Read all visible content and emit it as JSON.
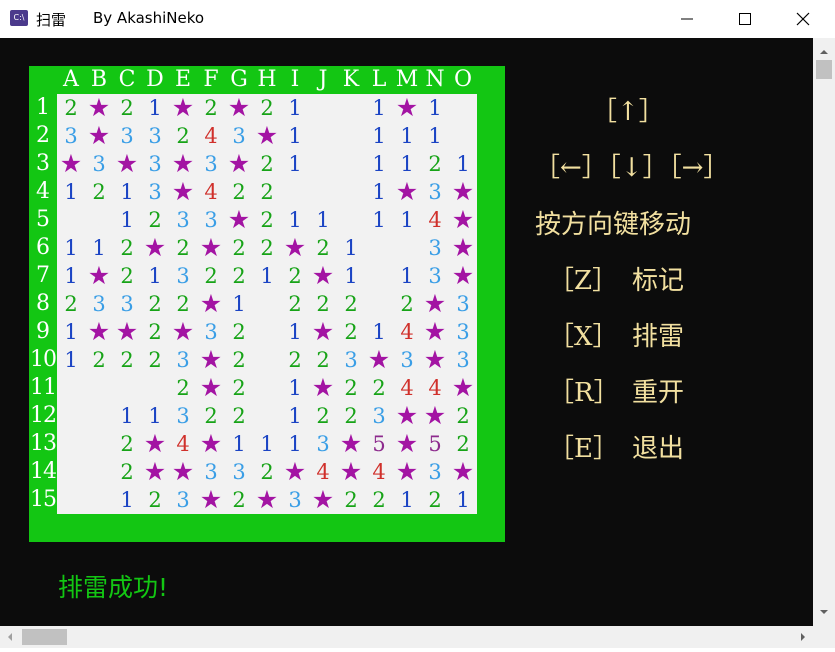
{
  "window": {
    "title": "扫雷",
    "author": "By AkashiNeko",
    "icon_label": "C:\\"
  },
  "colors": {
    "board_green": "#13c613",
    "mine": "#a314a3",
    "text_yellow": "#f2e0a0",
    "console_bg": "#0c0c0c"
  },
  "columns": [
    "A",
    "B",
    "C",
    "D",
    "E",
    "F",
    "G",
    "H",
    "I",
    "J",
    "K",
    "L",
    "M",
    "N",
    "O"
  ],
  "rows": [
    "1",
    "2",
    "3",
    "4",
    "5",
    "6",
    "7",
    "8",
    "9",
    "10",
    "11",
    "12",
    "13",
    "14",
    "15"
  ],
  "grid": [
    [
      "2",
      "*",
      "2",
      "1",
      "*",
      "2",
      "*",
      "2",
      "1",
      "",
      "",
      "1",
      "*",
      "1",
      ""
    ],
    [
      "3",
      "*",
      "3",
      "3",
      "2",
      "4",
      "3",
      "*",
      "1",
      "",
      "",
      "1",
      "1",
      "1",
      ""
    ],
    [
      "*",
      "3",
      "*",
      "3",
      "*",
      "3",
      "*",
      "2",
      "1",
      "",
      "",
      "1",
      "1",
      "2",
      "1"
    ],
    [
      "1",
      "2",
      "1",
      "3",
      "*",
      "4",
      "2",
      "2",
      "",
      "",
      "",
      "1",
      "*",
      "3",
      "*"
    ],
    [
      "",
      "",
      "1",
      "2",
      "3",
      "3",
      "*",
      "2",
      "1",
      "1",
      "",
      "1",
      "1",
      "4",
      "*"
    ],
    [
      "1",
      "1",
      "2",
      "*",
      "2",
      "*",
      "2",
      "2",
      "*",
      "2",
      "1",
      "",
      "",
      "3",
      "*"
    ],
    [
      "1",
      "*",
      "2",
      "1",
      "3",
      "2",
      "2",
      "1",
      "2",
      "*",
      "1",
      "",
      "1",
      "3",
      "*"
    ],
    [
      "2",
      "3",
      "3",
      "2",
      "2",
      "*",
      "1",
      "",
      "2",
      "2",
      "2",
      "",
      "2",
      "*",
      "3"
    ],
    [
      "1",
      "*",
      "*",
      "2",
      "*",
      "3",
      "2",
      "",
      "1",
      "*",
      "2",
      "1",
      "4",
      "*",
      "3"
    ],
    [
      "1",
      "2",
      "2",
      "2",
      "3",
      "*",
      "2",
      "",
      "2",
      "2",
      "3",
      "*",
      "3",
      "*",
      "3"
    ],
    [
      "",
      "",
      "",
      "",
      "2",
      "*",
      "2",
      "",
      "1",
      "*",
      "2",
      "2",
      "4",
      "4",
      "*"
    ],
    [
      "",
      "",
      "1",
      "1",
      "3",
      "2",
      "2",
      "",
      "1",
      "2",
      "2",
      "3",
      "*",
      "*",
      "2"
    ],
    [
      "",
      "",
      "2",
      "*",
      "4",
      "*",
      "1",
      "1",
      "1",
      "3",
      "*",
      "5",
      "*",
      "5",
      "2"
    ],
    [
      "",
      "",
      "2",
      "*",
      "*",
      "3",
      "3",
      "2",
      "*",
      "4",
      "*",
      "4",
      "*",
      "3",
      "*"
    ],
    [
      "",
      "",
      "1",
      "2",
      "3",
      "*",
      "2",
      "*",
      "3",
      "*",
      "2",
      "2",
      "1",
      "2",
      "1"
    ]
  ],
  "controls": {
    "up": "［↑］",
    "arrows": "［←］［↓］［→］",
    "hint": "按方向键移动",
    "mark_key": "［Z］",
    "mark_label": "标记",
    "sweep_key": "［X］",
    "sweep_label": "排雷",
    "restart_key": "［R］",
    "restart_label": "重开",
    "exit_key": "［E］",
    "exit_label": "退出"
  },
  "status": "排雷成功!"
}
